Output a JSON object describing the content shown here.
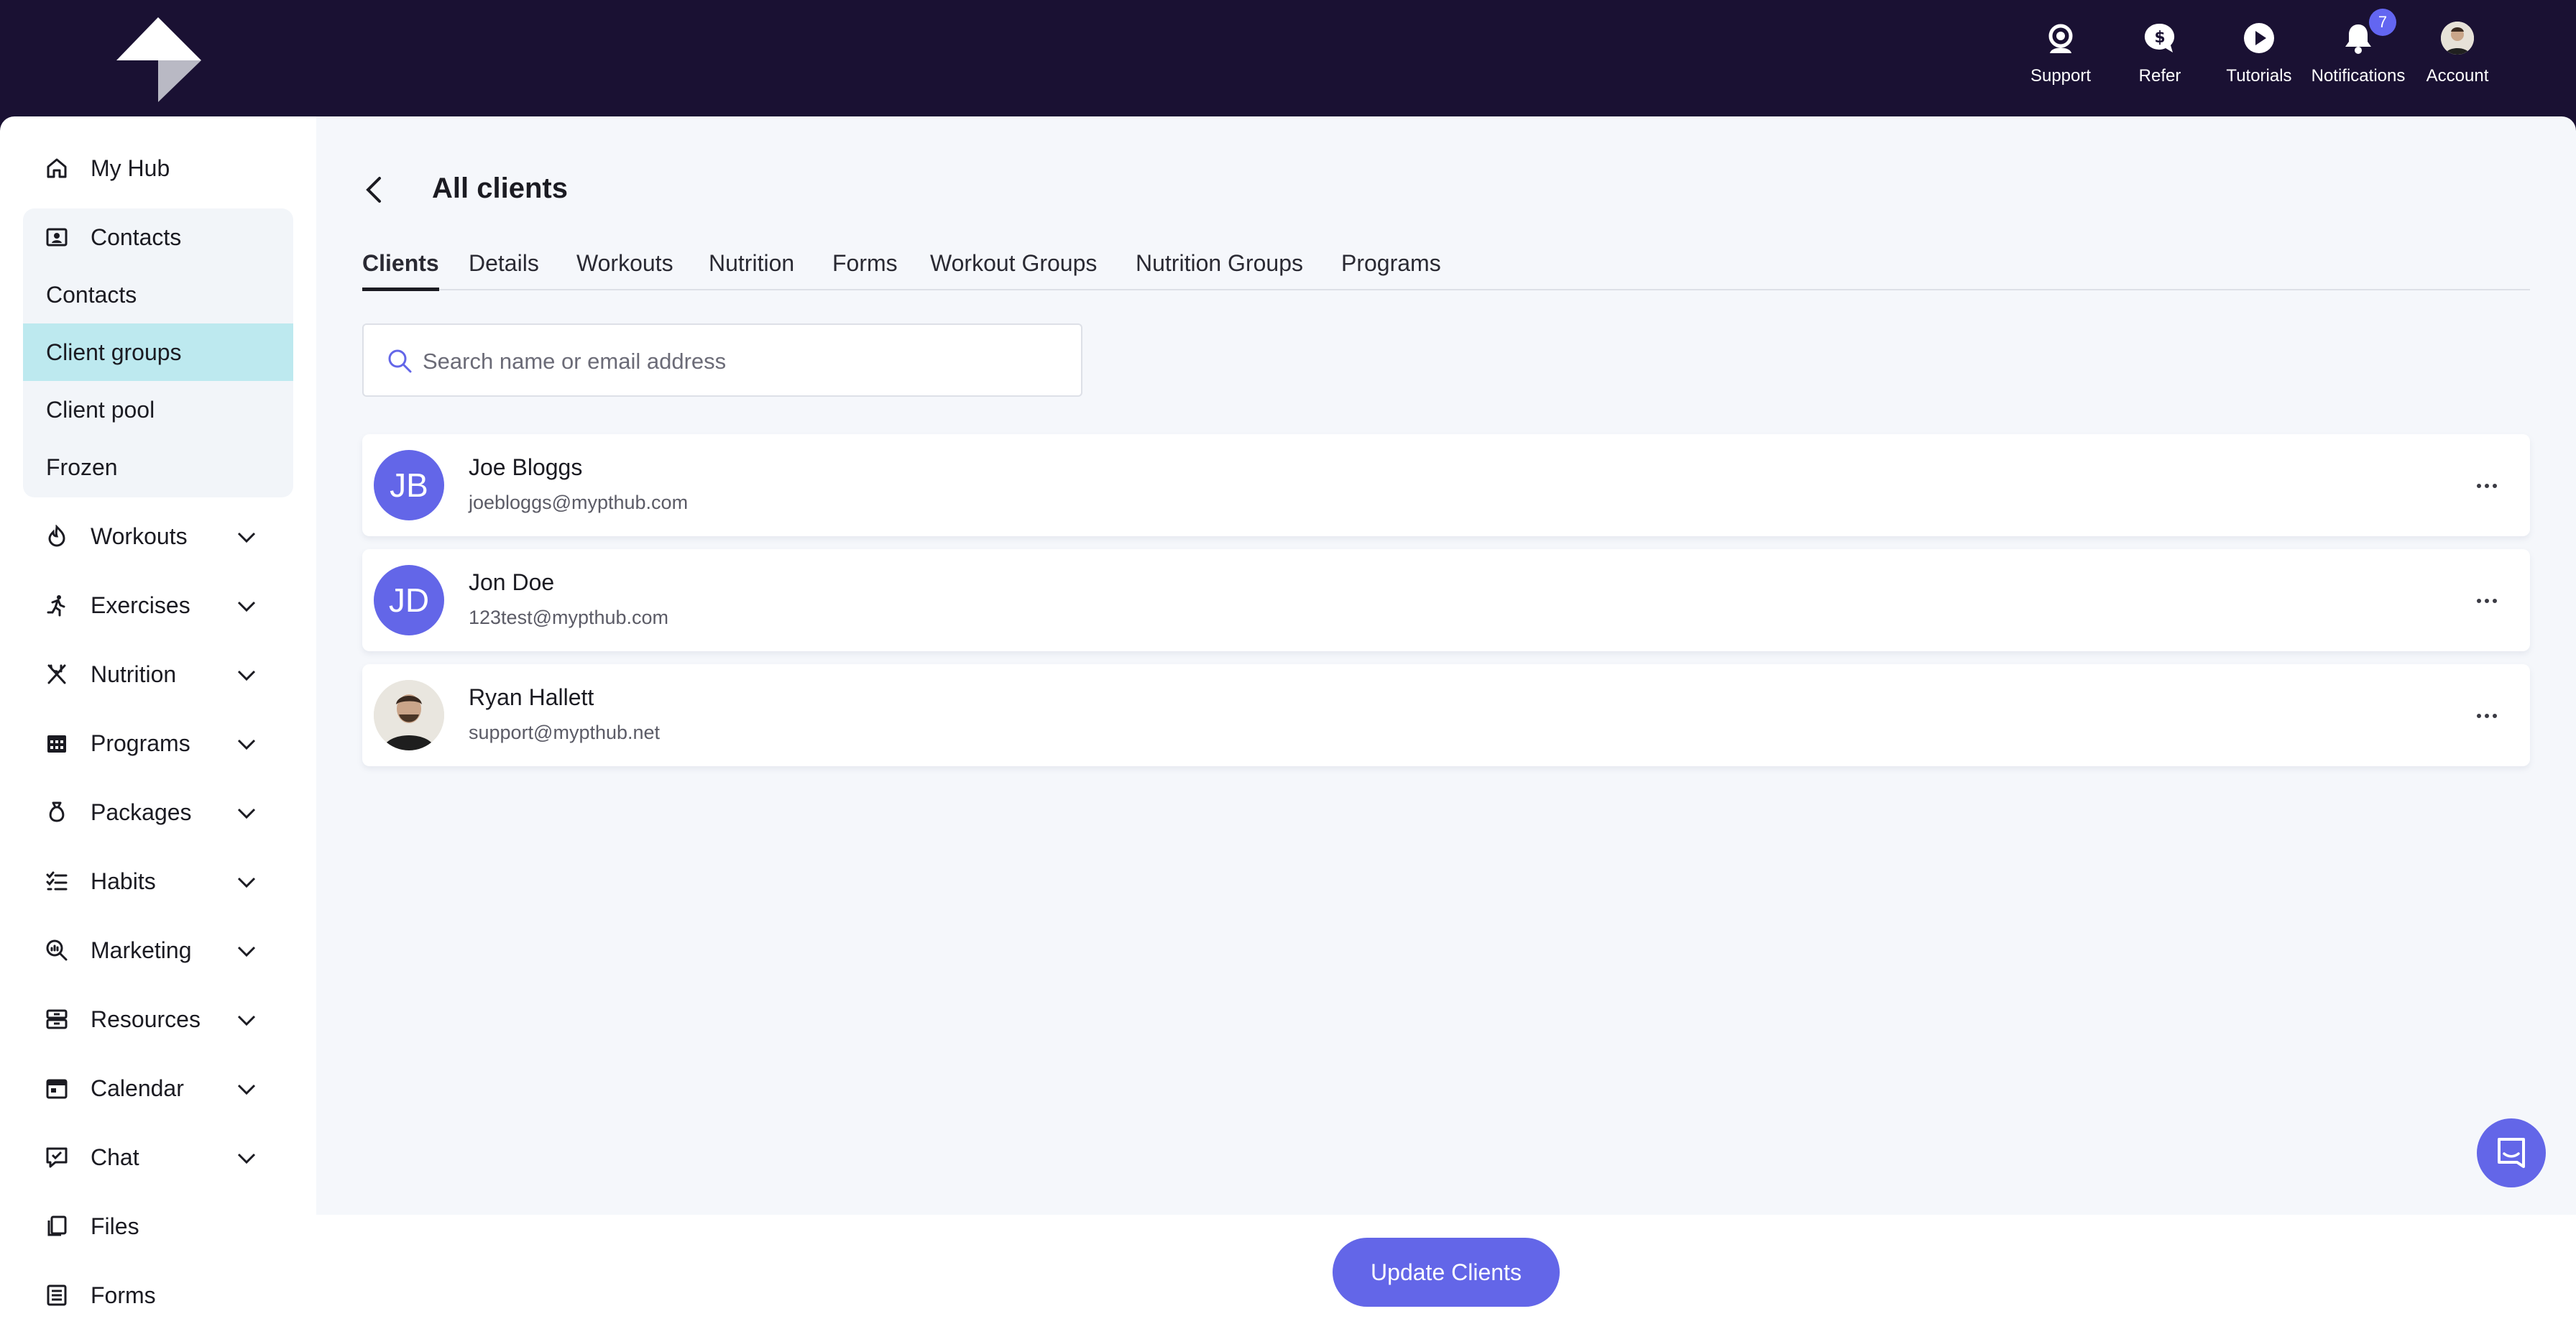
{
  "topnav": [
    {
      "label": "Support",
      "icon": "support-icon"
    },
    {
      "label": "Refer",
      "icon": "refer-icon"
    },
    {
      "label": "Tutorials",
      "icon": "play-icon"
    },
    {
      "label": "Notifications",
      "icon": "bell-icon",
      "badge": "7"
    },
    {
      "label": "Account",
      "icon": "account-avatar"
    }
  ],
  "sidebar": {
    "my_hub": "My Hub",
    "contacts": "Contacts",
    "contacts_sub": [
      "Contacts",
      "Client groups",
      "Client pool",
      "Frozen"
    ],
    "items": [
      "Workouts",
      "Exercises",
      "Nutrition",
      "Programs",
      "Packages",
      "Habits",
      "Marketing",
      "Resources",
      "Calendar",
      "Chat"
    ],
    "files": "Files",
    "forms": "Forms"
  },
  "page": {
    "title": "All clients",
    "tabs": [
      "Clients",
      "Details",
      "Workouts",
      "Nutrition",
      "Forms",
      "Workout Groups",
      "Nutrition Groups",
      "Programs"
    ],
    "search_placeholder": "Search name or email address"
  },
  "clients": [
    {
      "initials": "JB",
      "name": "Joe Bloggs",
      "email": "joebloggs@mypthub.com"
    },
    {
      "initials": "JD",
      "name": "Jon Doe",
      "email": "123test@mypthub.com"
    },
    {
      "initials": "",
      "name": "Ryan Hallett",
      "email": "support@mypthub.net"
    }
  ],
  "footer": {
    "update_label": "Update Clients"
  },
  "colors": {
    "topbar": "#1a1133",
    "accent": "#6366e8",
    "active_sub": "#bde9ef"
  }
}
